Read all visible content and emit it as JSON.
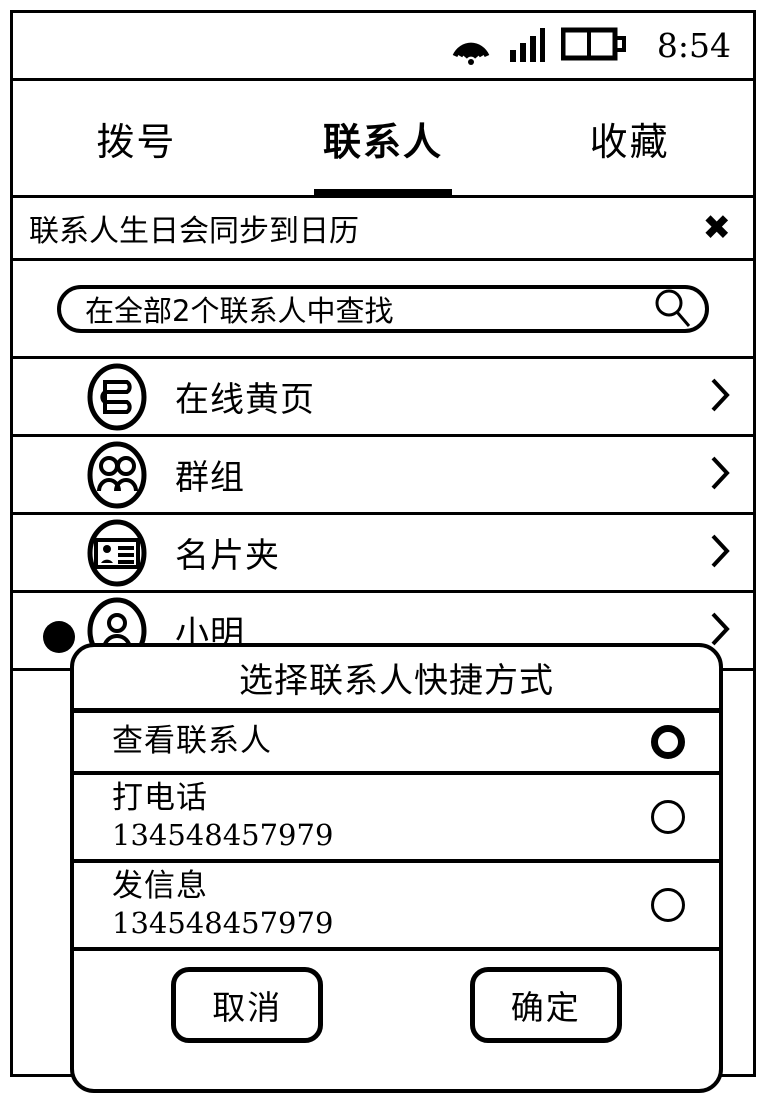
{
  "status_bar": {
    "wifi_icon": "wifi-icon",
    "signal_icon": "signal-bars-icon",
    "battery_icon": "battery-icon",
    "time": "8:54"
  },
  "tabs": [
    {
      "label": "拨号",
      "active": false
    },
    {
      "label": "联系人",
      "active": true
    },
    {
      "label": "收藏",
      "active": false
    }
  ],
  "banner": {
    "text": "联系人生日会同步到日历",
    "close_icon": "✖"
  },
  "search": {
    "placeholder": "在全部2个联系人中查找",
    "icon": "search-icon"
  },
  "list": [
    {
      "label": "在线黄页",
      "icon": "yellow-pages-icon",
      "chevron": "›"
    },
    {
      "label": "群组",
      "icon": "group-people-icon",
      "chevron": "›"
    },
    {
      "label": "名片夹",
      "icon": "business-card-icon",
      "chevron": "›"
    },
    {
      "label": "小明",
      "icon": "contact-avatar-icon",
      "chevron": "›"
    }
  ],
  "dialog": {
    "title": "选择联系人快捷方式",
    "options": [
      {
        "title": "查看联系人",
        "sub": "",
        "selected": true
      },
      {
        "title": "打电话",
        "sub": "134548457979",
        "selected": false
      },
      {
        "title": "发信息",
        "sub": "134548457979",
        "selected": false
      }
    ],
    "cancel_label": "取消",
    "confirm_label": "确定"
  },
  "colors": {
    "ink": "#000000",
    "paper": "#ffffff"
  }
}
